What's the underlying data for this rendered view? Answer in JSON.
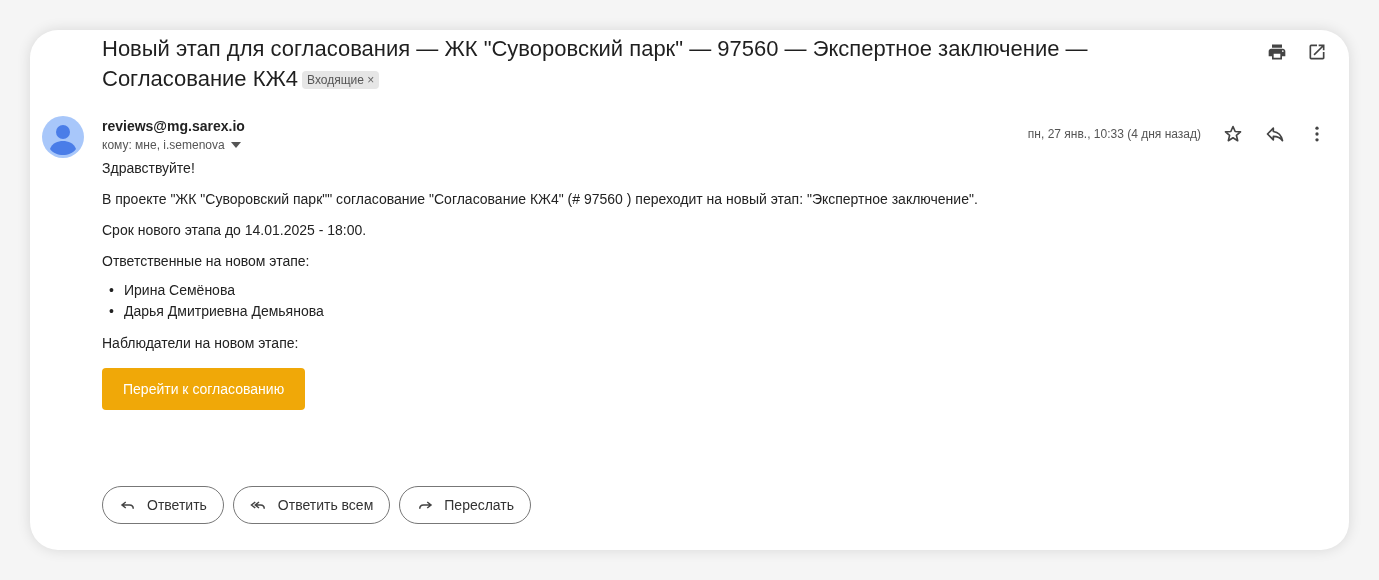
{
  "subject": {
    "title_lines": [
      "Новый этап для согласования — ЖК \"Суворовский парк\" — 97560 — Экспертное заключение —",
      "Согласование КЖ4"
    ],
    "label": "Входящие",
    "label_close": "×"
  },
  "message": {
    "sender": "reviews@mg.sarex.io",
    "recipients": "кому: мне, i.semenova",
    "date": "пн, 27 янв., 10:33 (4 дня назад)",
    "starred": false
  },
  "body": {
    "greeting": "Здравствуйте!",
    "paragraphs": [
      "В проекте \"ЖК \"Суворовский парк\"\" согласование \"Согласование КЖ4\" (# 97560 ) переходит на новый этап: \"Экспертное заключение\".",
      "Срок нового этапа до 14.01.2025 - 18:00.",
      "Ответственные на новом этапе:"
    ],
    "responsible": [
      {
        "bullet": "•",
        "name": "Ирина Семёнова"
      },
      {
        "bullet": "•",
        "name": "Дарья Дмитриевна Демьянова"
      }
    ],
    "observers": "Наблюдатели на новом этапе:",
    "cta": "Перейти к согласованию"
  },
  "actions": [
    {
      "kind": "reply",
      "label": "Ответить"
    },
    {
      "kind": "reply_all",
      "label": "Ответить всем"
    },
    {
      "kind": "forward",
      "label": "Переслать"
    }
  ]
}
